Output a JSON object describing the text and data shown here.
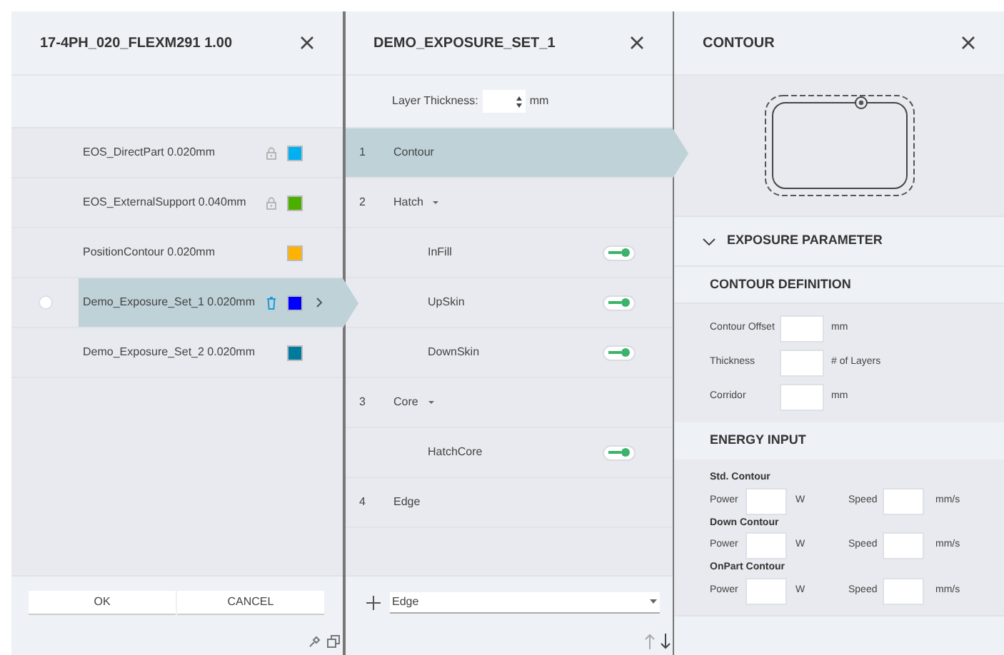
{
  "sets_panel": {
    "title": "17-4PH_020_FLEXM291 1.00",
    "items": [
      {
        "label": "EOS_DirectPart 0.020mm",
        "locked": true,
        "selected": false,
        "color": "#00b0f0"
      },
      {
        "label": "EOS_ExternalSupport 0.040mm",
        "locked": true,
        "selected": false,
        "color": "#4caf00"
      },
      {
        "label": "PositionContour 0.020mm",
        "locked": false,
        "selected": false,
        "color": "#ffb300"
      },
      {
        "label": "Demo_Exposure_Set_1 0.020mm",
        "locked": false,
        "selected": true,
        "checked": false,
        "color": "#0000ff"
      },
      {
        "label": "Demo_Exposure_Set_2 0.020mm",
        "locked": false,
        "selected": false,
        "color": "#007b9e"
      }
    ],
    "buttons": [
      "OK",
      "CANCEL"
    ]
  },
  "exposure_panel": {
    "title": "DEMO_EXPOSURE_SET_1",
    "layer_thickness_label": "Layer Thickness:",
    "layer_thickness_unit": "mm",
    "steps": [
      {
        "number": "1",
        "label": "Contour",
        "selected": true
      },
      {
        "number": "2",
        "label": "Hatch",
        "selected": false,
        "expanded": true,
        "children": [
          {
            "label": "InFill",
            "on": true
          },
          {
            "label": "UpSkin",
            "on": true
          },
          {
            "label": "DownSkin",
            "on": true
          }
        ]
      },
      {
        "number": "3",
        "label": "Core",
        "selected": false,
        "expanded": true,
        "children": [
          {
            "label": "HatchCore",
            "on": true
          }
        ]
      },
      {
        "number": "4",
        "label": "Edge",
        "selected": false
      }
    ],
    "add_select": {
      "value": "Edge"
    }
  },
  "contour_panel": {
    "title": "CONTOUR",
    "section": "EXPOSURE PARAMETER",
    "definition": {
      "title": "CONTOUR DEFINITION",
      "fields": [
        {
          "label": "Contour Offset",
          "unit": "mm"
        },
        {
          "label": "Thickness",
          "unit": "# of Layers"
        },
        {
          "label": "Corridor",
          "unit": "mm"
        }
      ]
    },
    "energy": {
      "title": "ENERGY INPUT",
      "groups": [
        {
          "title": "Std. Contour",
          "power_label": "Power",
          "power_unit": "W",
          "speed_label": "Speed",
          "speed_unit": "mm/s"
        },
        {
          "title": "Down Contour",
          "power_label": "Power",
          "power_unit": "W",
          "speed_label": "Speed",
          "speed_unit": "mm/s"
        },
        {
          "title": "OnPart Contour",
          "power_label": "Power",
          "power_unit": "W",
          "speed_label": "Speed",
          "speed_unit": "mm/s"
        }
      ]
    }
  }
}
